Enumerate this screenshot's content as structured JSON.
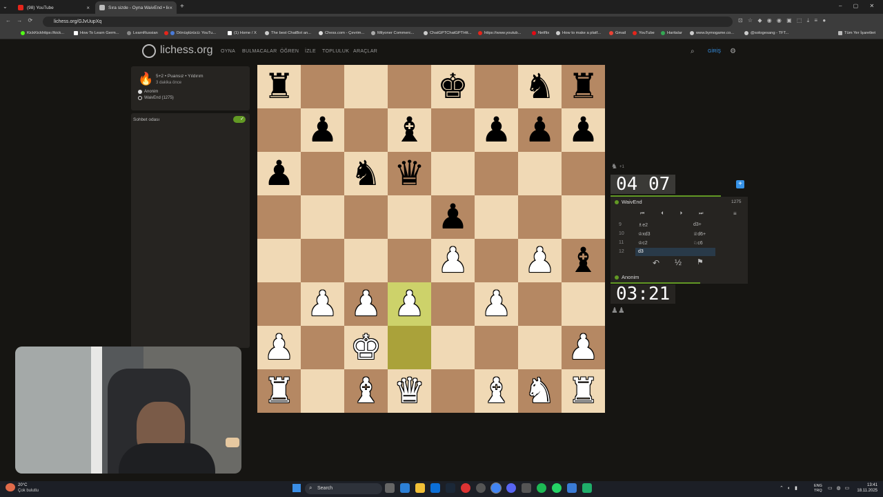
{
  "browser": {
    "tabs": [
      {
        "label": "(98) YouTube",
        "color": "#e5251b"
      },
      {
        "label": "Sıra sizde - Oyna WaivEnd • lic",
        "color": "#bbbbbb"
      }
    ],
    "url": "lichess.org/GJvUupXq",
    "bookmarks": [
      "KickKickhttps://kick...",
      "How To Learn Germ...",
      "LearnRussian",
      "Dönüştürücü: YouTu...",
      "(1) Home / X",
      "The best ChatBot an...",
      "Chess.com - Çevrim...",
      "Milyoner Commerc...",
      "ChatGPTChatGPTHtt...",
      "https://www.youtub...",
      "Netflix",
      "How to make a platf...",
      "Gmail",
      "YouTube",
      "Haritalar",
      "www.bymogame.co...",
      "@sologesang - TFT...",
      "Tüm Yer İşaretleri"
    ]
  },
  "site": {
    "logo": "lichess.org",
    "nav": [
      "OYNA",
      "BULMACALAR",
      "ÖĞREN",
      "İZLE",
      "TOPLULUK",
      "ARAÇLAR"
    ],
    "login": "GİRİŞ"
  },
  "game_info": {
    "setup": "5+2 • Puansız • Yıldırım",
    "time_ago": "3 dakika önce",
    "player_white": "Anonim",
    "player_black": "WaivEnd (1275)",
    "chat_label": "Sohbet odası"
  },
  "opponent": {
    "name": "WaivEnd",
    "rating": "1275",
    "clock": "04 07",
    "material": "+1"
  },
  "player": {
    "name": "Anonim",
    "clock": "03:21"
  },
  "moves": [
    {
      "n": "9",
      "w": "♗e2",
      "b": "d3+"
    },
    {
      "n": "10",
      "w": "♔xd3",
      "b": "♕d6+"
    },
    {
      "n": "11",
      "w": "♔c2",
      "b": "♘c6"
    },
    {
      "n": "12",
      "w": "d3",
      "b": ""
    }
  ],
  "board": {
    "ranks": [
      "r...k.nr",
      ".p.b.ppp",
      "p.nq....",
      "....p...",
      "....P.Pb",
      ".PPP.P..",
      "P.K....P",
      "R.BQ.BNR"
    ],
    "highlight": [
      "d3",
      "d2"
    ]
  },
  "taskbar": {
    "weather": "20°C",
    "weather_desc": "Çok bulutlu",
    "search": "Search",
    "lang": "ENG TRQ",
    "time": "13:41",
    "date": "18.11.2025"
  }
}
